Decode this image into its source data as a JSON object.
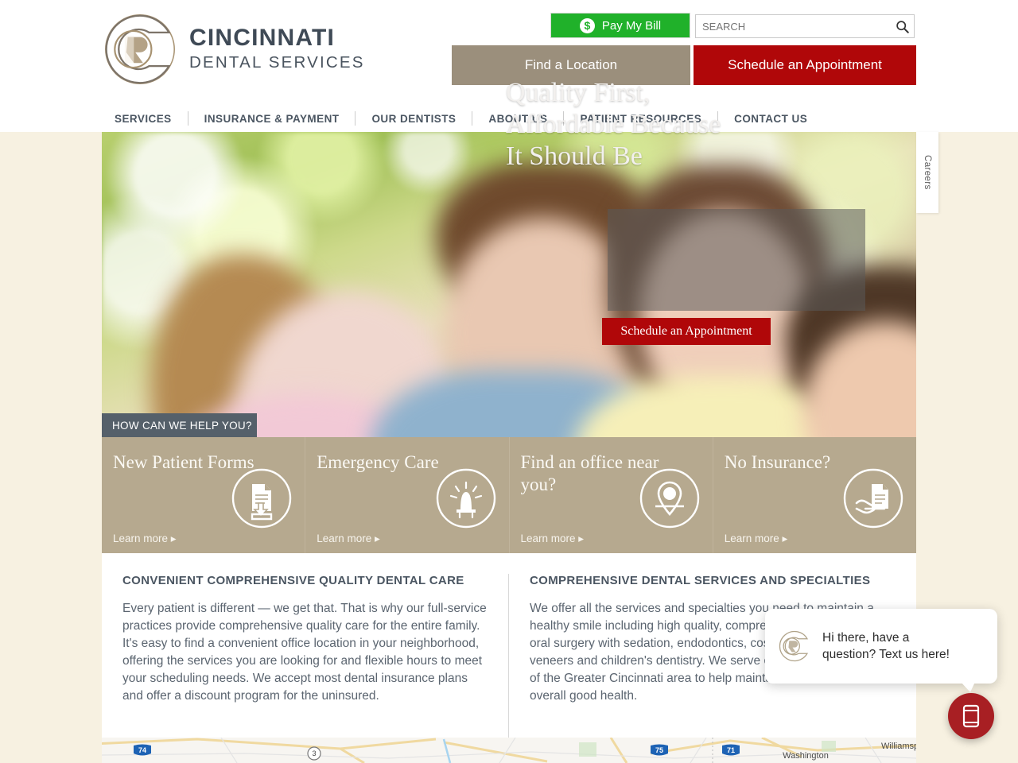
{
  "brand": {
    "name_line1": "CINCINNATI",
    "name_line2": "DENTAL SERVICES",
    "accent_red": "#b00709",
    "accent_tan": "#9b8f7c",
    "accent_green": "#20b12a",
    "card_tan": "#b6a98f",
    "page_cream": "#f7f1e1"
  },
  "header": {
    "pay_bill_label": "Pay My Bill",
    "search_placeholder": "SEARCH",
    "search_value": "",
    "find_location_label": "Find a Location",
    "schedule_label": "Schedule an Appointment"
  },
  "nav": {
    "items": [
      {
        "label": "SERVICES"
      },
      {
        "label": "INSURANCE & PAYMENT"
      },
      {
        "label": "OUR DENTISTS"
      },
      {
        "label": "ABOUT US"
      },
      {
        "label": "PATIENT RESOURCES"
      },
      {
        "label": "CONTACT US"
      }
    ]
  },
  "hero": {
    "headline_line1": "Quality First,",
    "headline_line2": "Affordable Because",
    "headline_line3": "It Should Be",
    "cta_label": "Schedule an Appointment",
    "help_tab_label": "HOW CAN WE HELP YOU?"
  },
  "careers_tab": {
    "label": "Careers"
  },
  "quick_cards": {
    "learn_more_label": "Learn more ▸",
    "items": [
      {
        "title": "New Patient Forms",
        "icon": "document-download-icon"
      },
      {
        "title": "Emergency Care",
        "icon": "emergency-light-icon"
      },
      {
        "title": "Find an office near you?",
        "icon": "map-pin-icon"
      },
      {
        "title": "No Insurance?",
        "icon": "hand-holding-document-icon"
      }
    ]
  },
  "content": {
    "left": {
      "heading": "CONVENIENT COMPREHENSIVE QUALITY DENTAL CARE",
      "body": "Every patient is different — we get that. That is why our full-service practices provide comprehensive quality care for the entire family. It's easy to find a convenient office location in your neighborhood, offering the services you are looking for and flexible hours to meet your scheduling needs. We accept most dental insurance plans and offer a discount program for the uninsured."
    },
    "right": {
      "heading": "COMPREHENSIVE DENTAL SERVICES AND SPECIALTIES",
      "body": "We offer all the services and specialties you need to maintain a healthy smile including high quality, comprehensive dentistry, and oral surgery with sedation, endodontics, cosmetic dentistry / veneers and children's dentistry. We serve our communities and all of the Greater Cincinnati area to help maintain healthier mouths for overall good health."
    }
  },
  "chat": {
    "message_line1": "Hi there, have a",
    "message_line2": "question? Text us here!",
    "fab_icon": "mobile-phone-icon"
  },
  "map": {
    "labels": [
      {
        "text": "74",
        "type": "interstate-shield"
      },
      {
        "text": "3",
        "type": "route-circle"
      },
      {
        "text": "75",
        "type": "interstate-shield"
      },
      {
        "text": "71",
        "type": "interstate-shield"
      },
      {
        "text": "Washington",
        "type": "place"
      },
      {
        "text": "Williamsport",
        "type": "place"
      }
    ]
  }
}
